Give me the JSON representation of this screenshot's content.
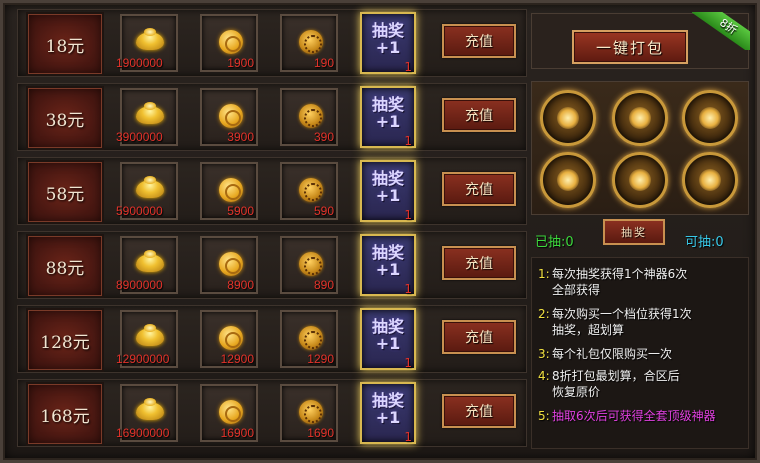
{
  "rows": [
    {
      "price": "18元",
      "ingot": "1900000",
      "coin": "1900",
      "medal": "190",
      "lottery_text": "抽奖\n+1",
      "lottery_qty": "1",
      "charge_label": "充值"
    },
    {
      "price": "38元",
      "ingot": "3900000",
      "coin": "3900",
      "medal": "390",
      "lottery_text": "抽奖\n+1",
      "lottery_qty": "1",
      "charge_label": "充值"
    },
    {
      "price": "58元",
      "ingot": "5900000",
      "coin": "5900",
      "medal": "590",
      "lottery_text": "抽奖\n+1",
      "lottery_qty": "1",
      "charge_label": "充值"
    },
    {
      "price": "88元",
      "ingot": "8900000",
      "coin": "8900",
      "medal": "890",
      "lottery_text": "抽奖\n+1",
      "lottery_qty": "1",
      "charge_label": "充值"
    },
    {
      "price": "128元",
      "ingot": "12900000",
      "coin": "12900",
      "medal": "1290",
      "lottery_text": "抽奖\n+1",
      "lottery_qty": "1",
      "charge_label": "充值"
    },
    {
      "price": "168元",
      "ingot": "16900000",
      "coin": "16900",
      "medal": "1690",
      "lottery_text": "抽奖\n+1",
      "lottery_qty": "1",
      "charge_label": "充值"
    }
  ],
  "bundle": {
    "button_label": "一键打包",
    "discount_badge": "8折"
  },
  "artifacts": [
    "artifact-1",
    "artifact-2",
    "artifact-3",
    "artifact-4",
    "artifact-5",
    "artifact-6"
  ],
  "counts": {
    "drawn": "已抽:0",
    "draw_button": "抽奖",
    "available": "可抽:0"
  },
  "rules": [
    {
      "num": "1:",
      "text": "每次抽奖获得1个神器6次",
      "cont": "全部获得"
    },
    {
      "num": "2:",
      "text": "每次购买一个档位获得1次",
      "cont": "抽奖，超划算"
    },
    {
      "num": "3:",
      "text": "每个礼包仅限购买一次",
      "cont": ""
    },
    {
      "num": "4:",
      "text": "8折打包最划算，合区后",
      "cont": "恢复原价"
    },
    {
      "num": "5:",
      "text": "抽取6次后可获得全套顶级神器",
      "cont": ""
    }
  ],
  "colors": {
    "qty_red": "#e2322a",
    "drawn_green": "#3cd83c",
    "available_cyan": "#38c8e8",
    "rule_num_yellow": "#f0e040",
    "special_magenta": "#e040e0",
    "discount_green": "#2a8a1a"
  }
}
